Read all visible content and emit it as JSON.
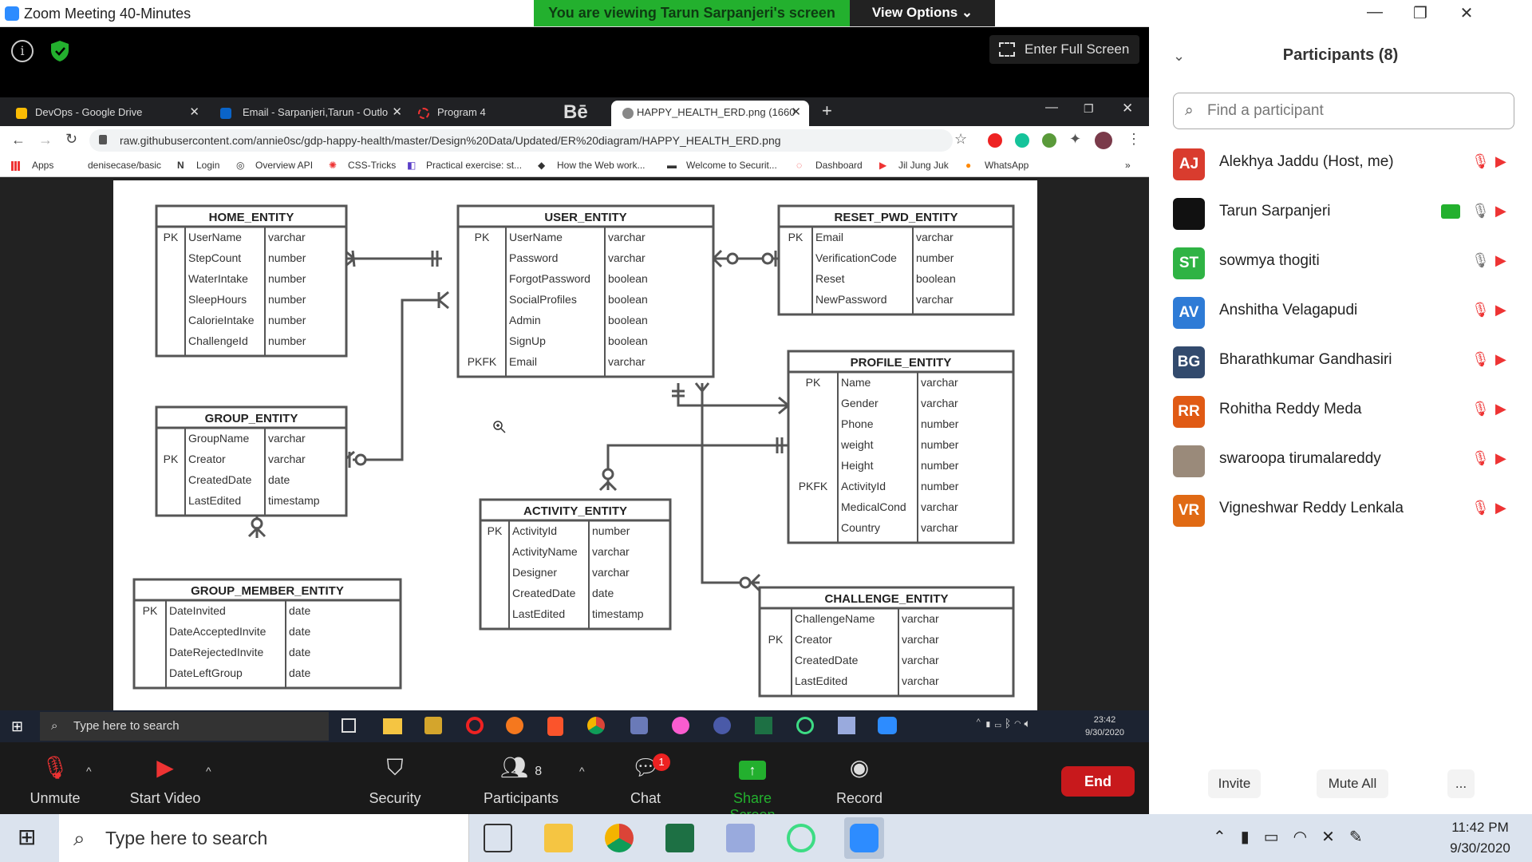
{
  "window": {
    "title": "Zoom Meeting 40-Minutes",
    "viewing_banner": "You are viewing Tarun Sarpanjeri's screen",
    "view_options": "View Options"
  },
  "share": {
    "enter_full_screen": "Enter Full Screen"
  },
  "browser": {
    "tabs": [
      {
        "label": "DevOps - Google Drive"
      },
      {
        "label": "Email - Sarpanjeri,Tarun - Outlo"
      },
      {
        "label": "Program 4"
      },
      {
        "label": "HAPPY_HEALTH_ERD.png (1660"
      }
    ],
    "url": "raw.githubusercontent.com/annie0sc/gdp-happy-health/master/Design%20Data/Updated/ER%20diagram/HAPPY_HEALTH_ERD.png",
    "bookmarks": [
      "Apps",
      "denisecase/basic",
      "Login",
      "Overview API",
      "CSS-Tricks",
      "Practical exercise: st...",
      "How the Web work...",
      "Welcome to Securit...",
      "Dashboard",
      "Jil Jung Juk",
      "WhatsApp"
    ]
  },
  "erd": {
    "entities": [
      {
        "name": "HOME_ENTITY",
        "keys": [
          "PK",
          "",
          "",
          "",
          "",
          ""
        ],
        "fields": [
          "UserName",
          "StepCount",
          "WaterIntake",
          "SleepHours",
          "CalorieIntake",
          "ChallengeId"
        ],
        "types": [
          "varchar",
          "number",
          "number",
          "number",
          "number",
          "number"
        ]
      },
      {
        "name": "USER_ENTITY",
        "keys": [
          "PK",
          "",
          "",
          "",
          "",
          "",
          "PKFK"
        ],
        "fields": [
          "UserName",
          "Password",
          "ForgotPassword",
          "SocialProfiles",
          "Admin",
          "SignUp",
          "Email"
        ],
        "types": [
          "varchar",
          "varchar",
          "boolean",
          "boolean",
          "boolean",
          "boolean",
          "varchar"
        ]
      },
      {
        "name": "RESET_PWD_ENTITY",
        "keys": [
          "PK",
          "",
          "",
          ""
        ],
        "fields": [
          "Email",
          "VerificationCode",
          "Reset",
          "NewPassword"
        ],
        "types": [
          "varchar",
          "number",
          "boolean",
          "varchar"
        ]
      },
      {
        "name": "PROFILE_ENTITY",
        "keys": [
          "PK",
          "",
          "",
          "",
          "",
          "PKFK",
          "",
          ""
        ],
        "fields": [
          "Name",
          "Gender",
          "Phone",
          "weight",
          "Height",
          "ActivityId",
          "MedicalCond",
          "Country"
        ],
        "types": [
          "varchar",
          "varchar",
          "number",
          "number",
          "number",
          "number",
          "varchar",
          "varchar"
        ]
      },
      {
        "name": "GROUP_ENTITY",
        "keys": [
          "",
          "PK",
          "",
          ""
        ],
        "fields": [
          "GroupName",
          "Creator",
          "CreatedDate",
          "LastEdited"
        ],
        "types": [
          "varchar",
          "varchar",
          "date",
          "timestamp"
        ]
      },
      {
        "name": "ACTIVITY_ENTITY",
        "keys": [
          "PK",
          "",
          "",
          "",
          ""
        ],
        "fields": [
          "ActivityId",
          "ActivityName",
          "Designer",
          "CreatedDate",
          "LastEdited"
        ],
        "types": [
          "number",
          "varchar",
          "varchar",
          "date",
          "timestamp"
        ]
      },
      {
        "name": "GROUP_MEMBER_ENTITY",
        "keys": [
          "PK",
          "",
          "",
          ""
        ],
        "fields": [
          "DateInvited",
          "DateAcceptedInvite",
          "DateRejectedInvite",
          "DateLeftGroup"
        ],
        "types": [
          "date",
          "date",
          "date",
          "date"
        ]
      },
      {
        "name": "CHALLENGE_ENTITY",
        "keys": [
          "",
          "PK",
          "",
          ""
        ],
        "fields": [
          "ChallengeName",
          "Creator",
          "CreatedDate",
          "LastEdited"
        ],
        "types": [
          "varchar",
          "varchar",
          "varchar",
          "varchar"
        ]
      }
    ]
  },
  "inner_taskbar": {
    "search": "Type here to search",
    "time": "23:42",
    "date": "9/30/2020"
  },
  "controls": {
    "unmute": "Unmute",
    "start_video": "Start Video",
    "security": "Security",
    "participants": "Participants",
    "participants_count": "8",
    "chat": "Chat",
    "chat_badge": "1",
    "share_screen": "Share Screen",
    "record": "Record",
    "end": "End"
  },
  "panel": {
    "title": "Participants (8)",
    "find_placeholder": "Find a participant",
    "participants": [
      {
        "initials": "AJ",
        "name": "Alekhya Jaddu (Host, me)",
        "color": "#d93c2e"
      },
      {
        "initials": "",
        "name": "Tarun Sarpanjeri",
        "color": "#111111"
      },
      {
        "initials": "ST",
        "name": "sowmya thogiti",
        "color": "#2fb344"
      },
      {
        "initials": "AV",
        "name": "Anshitha Velagapudi",
        "color": "#2e7bd6"
      },
      {
        "initials": "BG",
        "name": "Bharathkumar Gandhasiri",
        "color": "#324a6d"
      },
      {
        "initials": "RR",
        "name": "Rohitha Reddy Meda",
        "color": "#e05a14"
      },
      {
        "initials": "",
        "name": "swaroopa tirumalareddy",
        "color": "#9a8a7a"
      },
      {
        "initials": "VR",
        "name": "Vigneshwar Reddy Lenkala",
        "color": "#e06a14"
      }
    ],
    "invite": "Invite",
    "mute_all": "Mute All",
    "more": "..."
  },
  "windows": {
    "search": "Type here to search",
    "time": "11:42 PM",
    "date": "9/30/2020"
  }
}
